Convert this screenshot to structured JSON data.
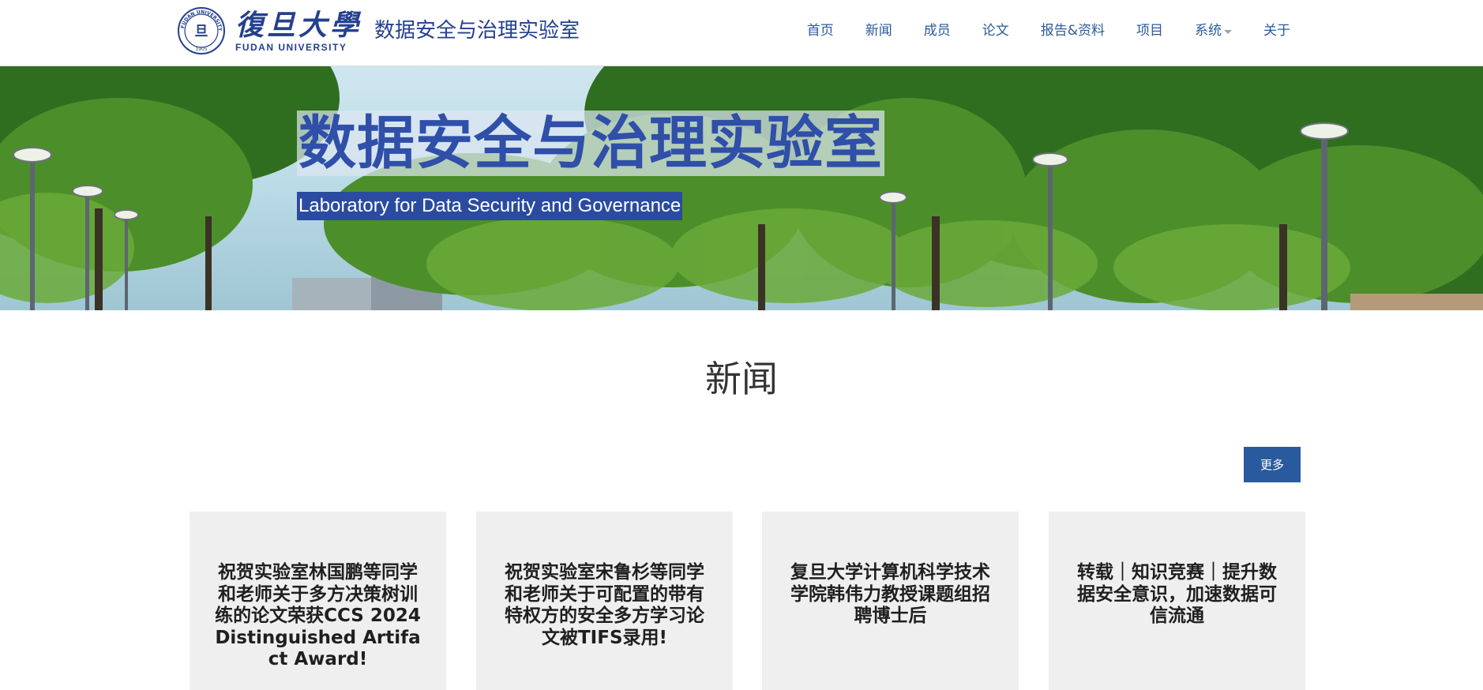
{
  "header": {
    "university_cn": "復旦大學",
    "university_en": "FUDAN UNIVERSITY",
    "seal_text": "FUDAN UNIVERSITY",
    "seal_year": "1905",
    "lab_name": "数据安全与治理实验室"
  },
  "nav": {
    "items": [
      {
        "label": "首页"
      },
      {
        "label": "新闻"
      },
      {
        "label": "成员"
      },
      {
        "label": "论文"
      },
      {
        "label": "报告&资料"
      },
      {
        "label": "项目"
      },
      {
        "label": "系统",
        "has_dropdown": true
      },
      {
        "label": "关于"
      }
    ]
  },
  "hero": {
    "title": "数据安全与治理实验室",
    "subtitle": "Laboratory for Data Security and Governance"
  },
  "news": {
    "heading": "新闻",
    "more_label": "更多",
    "cards": [
      {
        "title": "祝贺实验室林国鹏等同学和老师关于多方决策树训练的论文荣获CCS 2024 Distinguished Artifact Award!"
      },
      {
        "title": "祝贺实验室宋鲁杉等同学和老师关于可配置的带有特权方的安全多方学习论文被TIFS录用!"
      },
      {
        "title": "复旦大学计算机科学技术学院韩伟力教授课题组招聘博士后"
      },
      {
        "title": "转载｜知识竞赛｜提升数据安全意识，加速数据可信流通"
      }
    ]
  },
  "colors": {
    "brand_blue": "#24408e",
    "nav_link": "#2a5a9e",
    "button": "#2a5a9e",
    "card_bg": "#efefef"
  }
}
